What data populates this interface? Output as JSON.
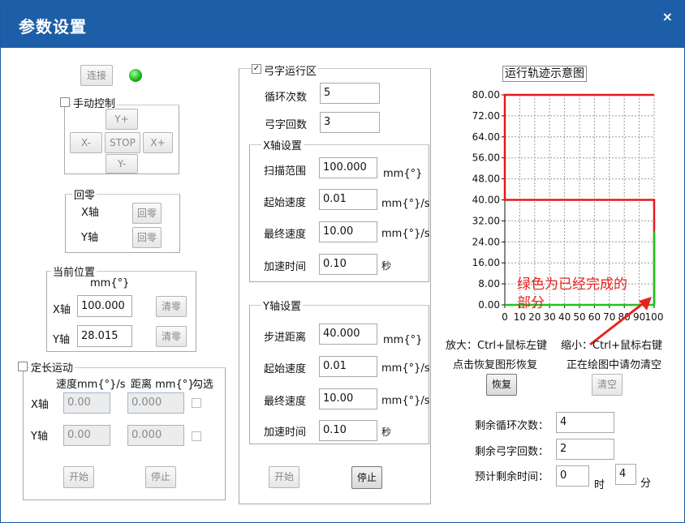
{
  "window": {
    "title": "参数设置",
    "close_glyph": "×"
  },
  "connect": {
    "button": "连接",
    "status_color": "#16b016"
  },
  "manual": {
    "label": "手动控制",
    "checked": false,
    "yplus": "Y+",
    "xminus": "X-",
    "stop": "STOP",
    "xplus": "X+",
    "yminus": "Y-"
  },
  "home": {
    "label": "回零",
    "x_label": "X轴",
    "y_label": "Y轴",
    "x_button": "回零",
    "y_button": "回零"
  },
  "position": {
    "label": "当前位置",
    "unit": "mm{°}",
    "x_label": "X轴",
    "x_value": "100.000",
    "x_clear": "清零",
    "y_label": "Y轴",
    "y_value": "28.015",
    "y_clear": "清零"
  },
  "fixed": {
    "label": "定长运动",
    "checked": false,
    "speed_header": "速度mm{°}/s",
    "distance_header": "距离 mm{°}",
    "check_header": "勾选",
    "x_label": "X轴",
    "x_speed": "0.00",
    "x_distance": "0.000",
    "y_label": "Y轴",
    "y_speed": "0.00",
    "y_distance": "0.000",
    "start": "开始",
    "stop": "停止"
  },
  "zigzag": {
    "label": "弓字运行区",
    "checked": true,
    "loops_label": "循环次数",
    "loops_value": "5",
    "bows_label": "弓字回数",
    "bows_value": "3",
    "x_axis": {
      "label": "X轴设置",
      "range_label": "扫描范围",
      "range_value": "100.000",
      "range_unit": "mm{°}",
      "start_label": "起始速度",
      "start_value": "0.01",
      "start_unit": "mm{°}/s",
      "end_label": "最终速度",
      "end_value": "10.00",
      "end_unit": "mm{°}/s",
      "accel_label": "加速时间",
      "accel_value": "0.10",
      "accel_unit": "秒"
    },
    "y_axis": {
      "label": "Y轴设置",
      "step_label": "步进距离",
      "step_value": "40.000",
      "step_unit": "mm{°}",
      "start_label": "起始速度",
      "start_value": "0.01",
      "start_unit": "mm{°}/s",
      "end_label": "最终速度",
      "end_value": "10.00",
      "end_unit": "mm{°}/s",
      "accel_label": "加速时间",
      "accel_value": "0.10",
      "accel_unit": "秒"
    },
    "start": "开始",
    "stop": "停止"
  },
  "trajectory": {
    "title": "运行轨迹示意图",
    "annotation_line1": "绿色为已经完成的",
    "annotation_line2": "部分",
    "annotation_color": "#e8231f",
    "zoom_in": "放大：Ctrl+鼠标左键",
    "zoom_out": "缩小：Ctrl+鼠标右键",
    "restore_hint": "点击恢复图形恢复",
    "no_clear_hint": "正在绘图中请勿清空",
    "restore": "恢复",
    "clear": "清空"
  },
  "chart_data": {
    "type": "line",
    "title": "运行轨迹示意图",
    "xlim": [
      0,
      100
    ],
    "ylim": [
      0,
      80
    ],
    "x_ticks": [
      "0",
      "10",
      "20",
      "30",
      "40",
      "50",
      "60",
      "70",
      "80",
      "90",
      "100"
    ],
    "y_ticks": [
      "0.00",
      "8.00",
      "16.00",
      "24.00",
      "32.00",
      "40.00",
      "48.00",
      "56.00",
      "64.00",
      "72.00",
      "80.00"
    ],
    "grid": true,
    "series": [
      {
        "color": "#e41a1a",
        "points": [
          [
            100,
            0
          ],
          [
            100,
            40
          ],
          [
            0,
            40
          ],
          [
            0,
            80
          ],
          [
            100,
            80
          ]
        ]
      },
      {
        "color": "#22c322",
        "points": [
          [
            0,
            0
          ],
          [
            100,
            0
          ],
          [
            100,
            28.015
          ]
        ]
      }
    ]
  },
  "remaining": {
    "loops_label": "剩余循环次数：",
    "loops_value": "4",
    "bows_label": "剩余弓字回数：",
    "bows_value": "2",
    "time_label": "预计剩余时间：",
    "hours_value": "0",
    "hours_unit": "时",
    "minutes_value": "4",
    "minutes_unit": "分"
  }
}
